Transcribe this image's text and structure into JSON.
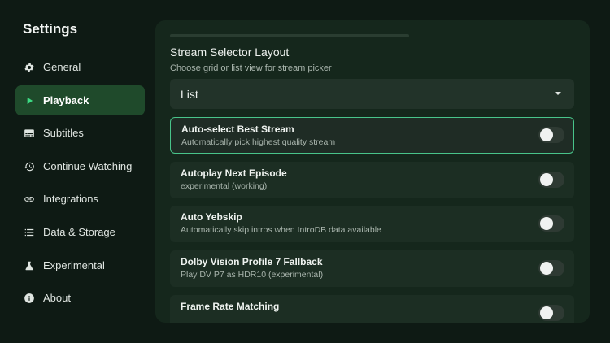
{
  "sidebar": {
    "title": "Settings",
    "items": [
      {
        "label": "General",
        "icon": "gear-icon"
      },
      {
        "label": "Playback",
        "icon": "play-icon",
        "active": true
      },
      {
        "label": "Subtitles",
        "icon": "subtitles-icon"
      },
      {
        "label": "Continue Watching",
        "icon": "history-icon"
      },
      {
        "label": "Integrations",
        "icon": "link-icon"
      },
      {
        "label": "Data & Storage",
        "icon": "list-icon"
      },
      {
        "label": "Experimental",
        "icon": "flask-icon"
      },
      {
        "label": "About",
        "icon": "info-icon"
      }
    ]
  },
  "panel": {
    "section_title": "Stream Selector Layout",
    "section_subtitle": "Choose grid or list view for stream picker",
    "dropdown_value": "List",
    "settings": [
      {
        "title": "Auto-select Best Stream",
        "subtitle": "Automatically pick highest quality stream",
        "enabled": false,
        "focused": true
      },
      {
        "title": "Autoplay Next Episode",
        "subtitle": "experimental (working)",
        "enabled": false
      },
      {
        "title": "Auto Yebskip",
        "subtitle": "Automatically skip intros when IntroDB data available",
        "enabled": false
      },
      {
        "title": "Dolby Vision Profile 7 Fallback",
        "subtitle": "Play DV P7 as HDR10 (experimental)",
        "enabled": false
      },
      {
        "title": "Frame Rate Matching",
        "subtitle": "",
        "enabled": false
      }
    ]
  },
  "colors": {
    "background": "#0e1a14",
    "panel": "#15271c",
    "active_nav": "#1f4a2b",
    "focus_border": "#48c48a",
    "accent": "#3ddc84"
  }
}
